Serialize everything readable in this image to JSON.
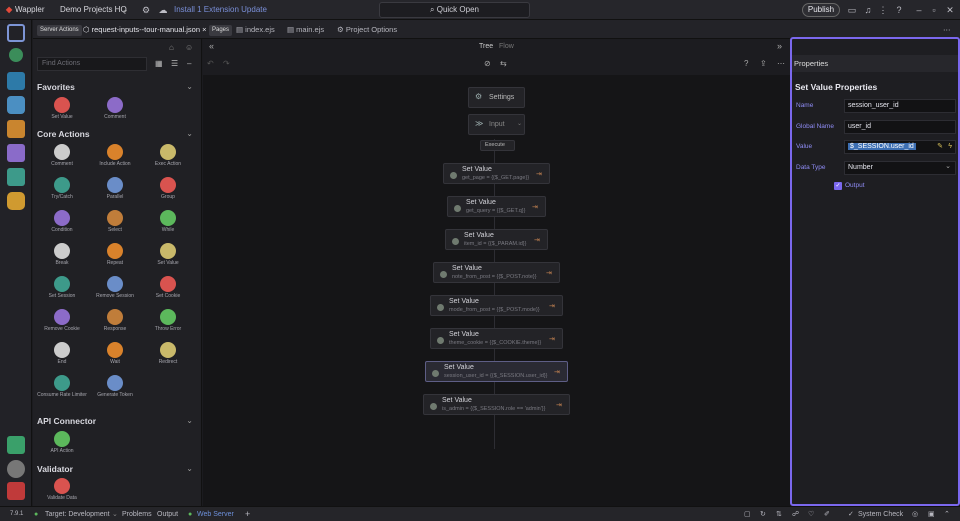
{
  "topbar": {
    "app_name": "Wappler",
    "project": "Demo Projects HQ",
    "install_update": "Install 1 Extension Update",
    "quick_open": "Quick Open",
    "publish": "Publish"
  },
  "tabs": {
    "server_actions_chip": "Server Actions",
    "active_file": "request-inputs--tour-manual.json",
    "pages_chip": "Pages",
    "file2": "index.ejs",
    "file3": "main.ejs",
    "project_options": "Project Options"
  },
  "panel": {
    "search_placeholder": "Find Actions",
    "sections": {
      "favorites": "Favorites",
      "core_actions": "Core Actions",
      "api_connector": "API Connector",
      "validator": "Validator"
    },
    "favorites": [
      "Set Value",
      "Comment"
    ],
    "core": [
      "Comment",
      "Include Action",
      "Exec Action",
      "Try/Catch",
      "Parallel",
      "Group",
      "Condition",
      "Select",
      "While",
      "Break",
      "Repeat",
      "Set Value",
      "Set Session",
      "Remove Session",
      "Set Cookie",
      "Remove Cookie",
      "Response",
      "Throw Error",
      "End",
      "Wait",
      "Redirect",
      "Consume Rate Limiter",
      "Generate Token"
    ],
    "api": [
      "API Action"
    ],
    "validator": [
      "Validate Data"
    ]
  },
  "canvas": {
    "view_tree": "Tree",
    "view_flow": "Flow",
    "settings": "Settings",
    "input": "Input",
    "execute": "Execute",
    "steps": [
      {
        "title": "Set Value",
        "expr": "get_page = {{$_GET.page}}"
      },
      {
        "title": "Set Value",
        "expr": "get_query = {{$_GET.q}}"
      },
      {
        "title": "Set Value",
        "expr": "item_id = {{$_PARAM.id}}"
      },
      {
        "title": "Set Value",
        "expr": "note_from_post = {{$_POST.note}}"
      },
      {
        "title": "Set Value",
        "expr": "mode_from_post = {{$_POST.mode}}"
      },
      {
        "title": "Set Value",
        "expr": "theme_cookie = {{$_COOKIE.theme}}"
      },
      {
        "title": "Set Value",
        "expr": "session_user_id = {{$_SESSION.user_id}}"
      },
      {
        "title": "Set Value",
        "expr": "is_admin = {{$_SESSION.role == 'admin'}}"
      }
    ]
  },
  "properties": {
    "header": "Properties",
    "title": "Set Value Properties",
    "name_label": "Name",
    "name_value": "session_user_id",
    "global_label": "Global Name",
    "global_value": "user_id",
    "value_label": "Value",
    "value_value": "$_SESSION.user_id",
    "type_label": "Data Type",
    "type_value": "Number",
    "output_label": "Output"
  },
  "status": {
    "version": "7.9.1",
    "target": "Target: Development",
    "problems": "Problems",
    "output": "Output",
    "web_server": "Web Server",
    "system_check": "System Check"
  },
  "colors": {
    "accent": "#7b68ee",
    "green": "#5cb85c",
    "brand": "#d9534f"
  }
}
